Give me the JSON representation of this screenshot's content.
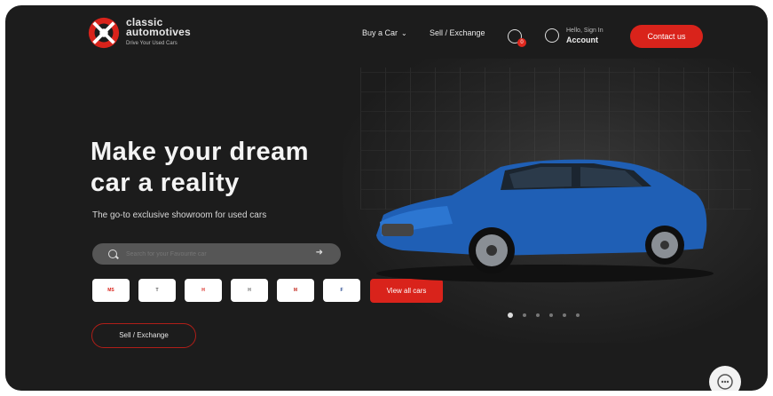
{
  "brand": {
    "name_line1": "classic",
    "name_line2": "automotives",
    "tagline": "Drive Your Used Cars",
    "colors": {
      "accent": "#d9231b",
      "background": "#1c1c1c"
    }
  },
  "nav": {
    "buy": "Buy a Car",
    "sell": "Sell / Exchange"
  },
  "wishlist": {
    "count": "0"
  },
  "account": {
    "greeting": "Hello, Sign In",
    "label": "Account"
  },
  "contact": "Contact us",
  "hero": {
    "headline_line1": "Make your dream",
    "headline_line2": "car a reality",
    "subtitle": "The go-to exclusive showroom for used cars"
  },
  "search": {
    "placeholder": "Search for your Favourite car"
  },
  "brands": [
    "Maruti Suzuki",
    "Toyota",
    "Honda",
    "Hyundai",
    "Mahindra",
    "Ford"
  ],
  "view_all": "View all cars",
  "sell_button": "Sell / Exchange",
  "carousel": {
    "slides": 6,
    "active": 0
  },
  "icons": {
    "search": "search-icon",
    "arrow": "arrow-right-icon",
    "heart": "heart-icon",
    "user": "user-icon",
    "chat": "chat-icon"
  }
}
